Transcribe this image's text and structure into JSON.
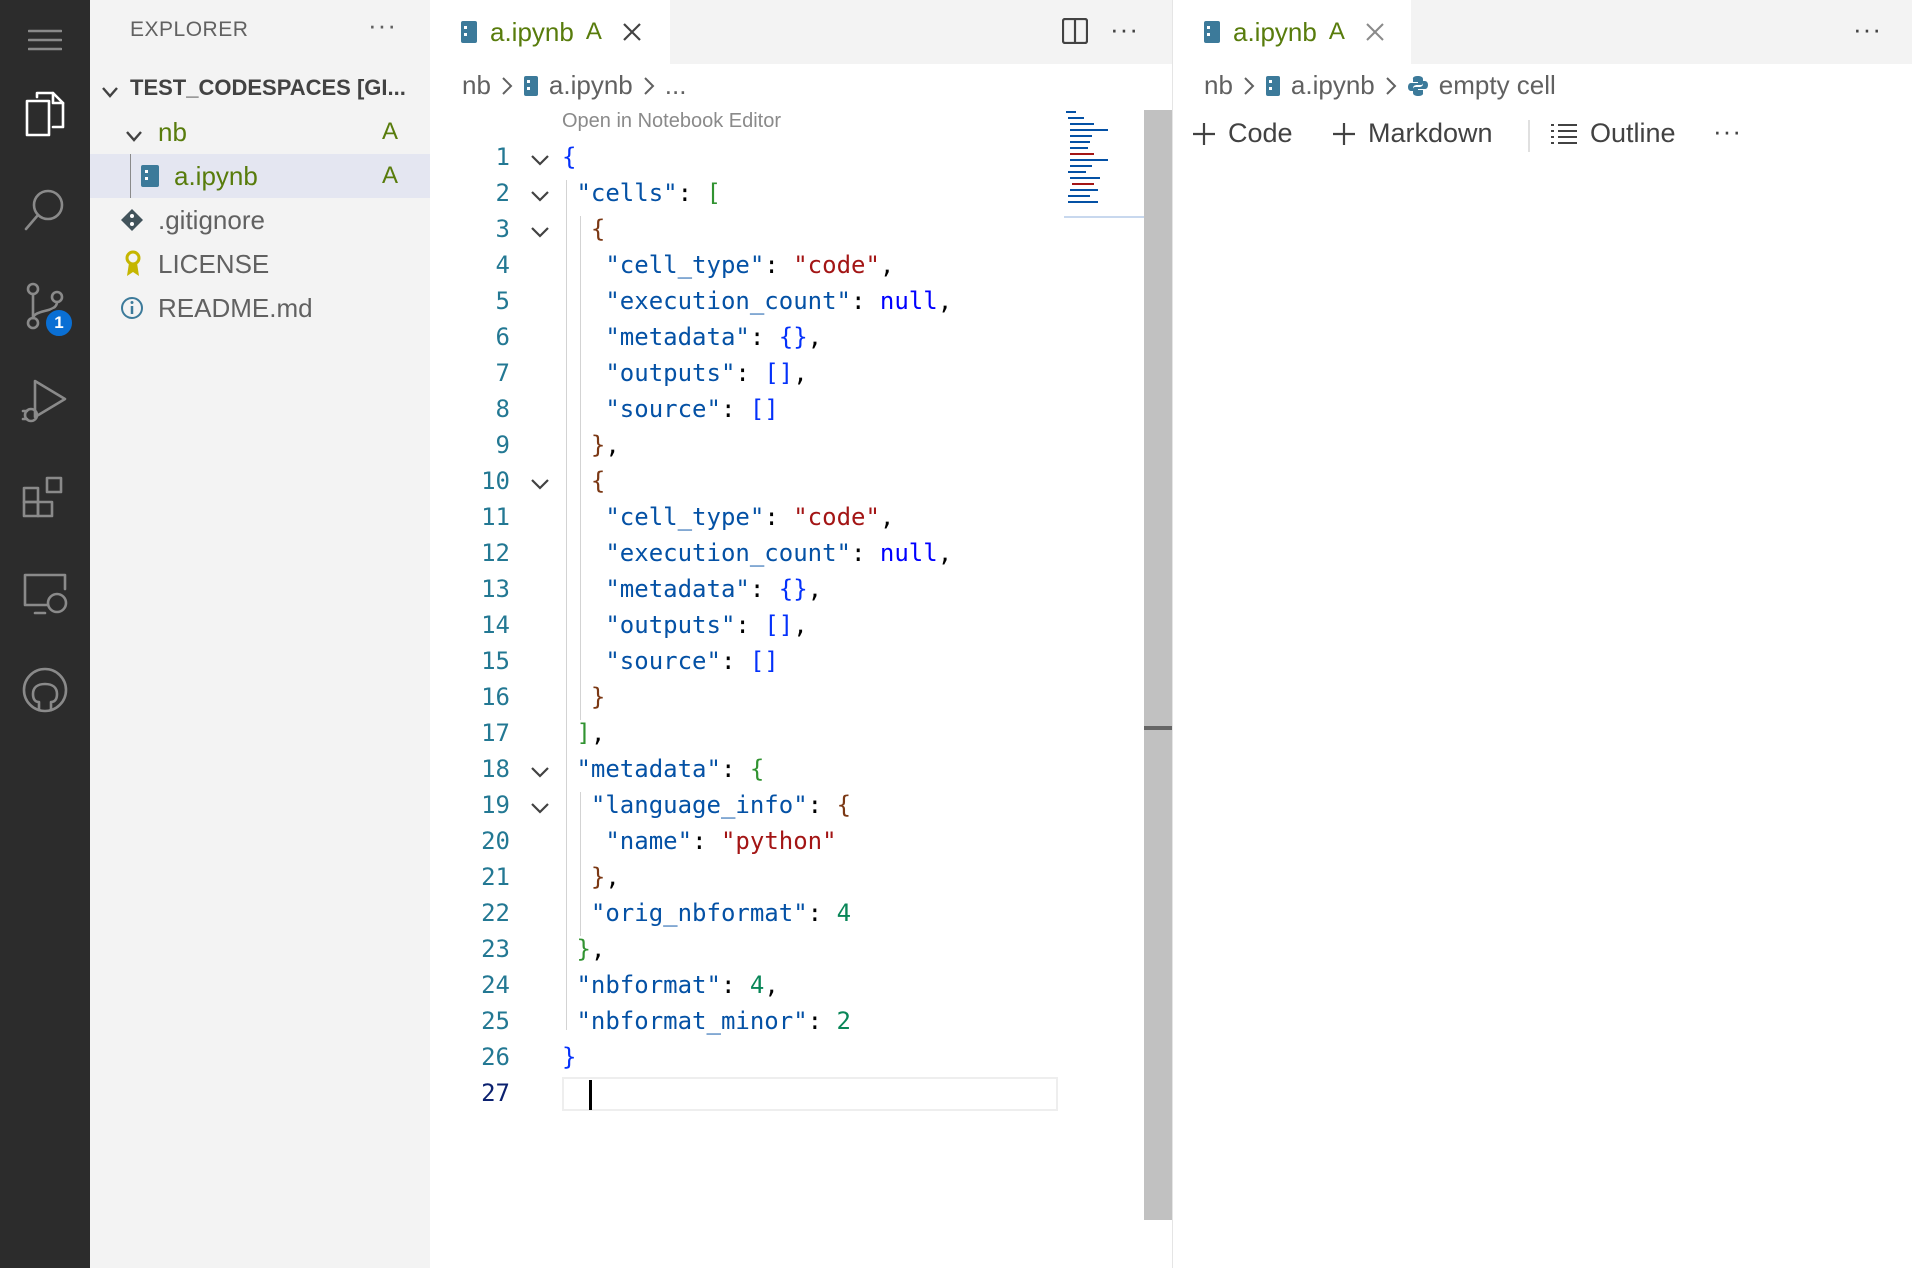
{
  "sidebar": {
    "title": "EXPLORER",
    "more": "···",
    "root": "TEST_CODESPACES [GI...",
    "items": [
      {
        "label": "nb",
        "badge": "A"
      },
      {
        "label": "a.ipynb",
        "badge": "A"
      },
      {
        "label": ".gitignore",
        "badge": ""
      },
      {
        "label": "LICENSE",
        "badge": ""
      },
      {
        "label": "README.md",
        "badge": ""
      }
    ]
  },
  "activity_bar": {
    "icons": [
      "menu-icon",
      "explorer-icon",
      "search-icon",
      "source-control-icon",
      "run-debug-icon",
      "extensions-icon",
      "remote-explorer-icon",
      "github-icon"
    ],
    "source_control_badge": "1"
  },
  "editor_left": {
    "tab": {
      "label": "a.ipynb",
      "status": "A"
    },
    "more": "···",
    "breadcrumb": [
      "nb",
      "a.ipynb",
      "..."
    ],
    "codelens": "Open in Notebook Editor",
    "lines": [
      "1",
      "2",
      "3",
      "4",
      "5",
      "6",
      "7",
      "8",
      "9",
      "10",
      "11",
      "12",
      "13",
      "14",
      "15",
      "16",
      "17",
      "18",
      "19",
      "20",
      "21",
      "22",
      "23",
      "24",
      "25",
      "26",
      "27"
    ],
    "code": {
      "l1": "{",
      "l2_key": "\"cells\"",
      "l2_rest": ": ",
      "l2_br": "[",
      "l3": "{",
      "l4_key": "\"cell_type\"",
      "l4_val": "\"code\"",
      "l5_key": "\"execution_count\"",
      "l5_val": "null",
      "l6_key": "\"metadata\"",
      "l6_val": "{}",
      "l7_key": "\"outputs\"",
      "l7_val": "[]",
      "l8_key": "\"source\"",
      "l8_val": "[]",
      "l9": "}",
      "l10": "{",
      "l11_key": "\"cell_type\"",
      "l11_val": "\"code\"",
      "l12_key": "\"execution_count\"",
      "l12_val": "null",
      "l13_key": "\"metadata\"",
      "l13_val": "{}",
      "l14_key": "\"outputs\"",
      "l14_val": "[]",
      "l15_key": "\"source\"",
      "l15_val": "[]",
      "l16": "}",
      "l17": "]",
      "l18_key": "\"metadata\"",
      "l18_br": "{",
      "l19_key": "\"language_info\"",
      "l19_br": "{",
      "l20_key": "\"name\"",
      "l20_val": "\"python\"",
      "l21": "}",
      "l22_key": "\"orig_nbformat\"",
      "l22_val": "4",
      "l23": "}",
      "l24_key": "\"nbformat\"",
      "l24_val": "4",
      "l25_key": "\"nbformat_minor\"",
      "l25_val": "2",
      "l26": "}"
    }
  },
  "editor_right": {
    "tab": {
      "label": "a.ipynb",
      "status": "A"
    },
    "more": "···",
    "breadcrumb": [
      "nb",
      "a.ipynb",
      "empty cell"
    ],
    "toolbar": {
      "code": "Code",
      "markdown": "Markdown",
      "outline": "Outline",
      "more": "···"
    }
  }
}
